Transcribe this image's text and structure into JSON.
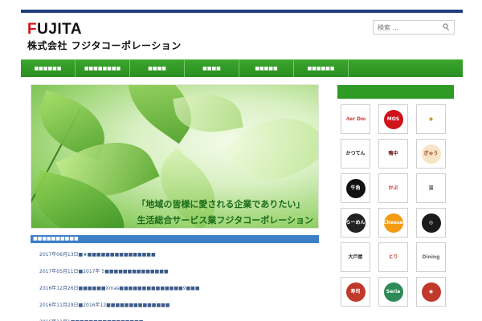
{
  "header": {
    "logo_mark_prefix": "F",
    "logo_mark_rest": "UJITA",
    "logo_sub": "株式会社 フジタコーポレーション",
    "search_placeholder": "検索 ...",
    "search_icon": "search-icon"
  },
  "nav": {
    "items": [
      "■■■■■■",
      "■■■■■■■■",
      "■■■■",
      "■■■■",
      "■■■■■",
      "■■■■■■"
    ]
  },
  "hero": {
    "line1": "「地域の皆様に愛される企業でありたい」",
    "line2": "生活総合サービス業フジタコーポレーション"
  },
  "news": {
    "header": "■■■■■■■■■■",
    "items": [
      "2017年06月13日■★■■■■■■■■■■■■■■■",
      "2017年05月11日■2017年 5■■■■■■■■■■■■■■",
      "2016年12月26日■■■■■■Xmas■■■■■■■■■■■■■■9■■■",
      "2016年11月29日■2016年12■■■■■■■■■■■■■■",
      "2016年11月1■■■■■■■■■■■■■■■■"
    ]
  },
  "brands": [
    {
      "label": "Mister\nDonut",
      "color": "#c0392b",
      "bg": "#ffffff"
    },
    {
      "label": "MOS",
      "color": "#ffffff",
      "bg": "#d0121b"
    },
    {
      "label": "◉",
      "color": "#b8860b",
      "bg": "#ffffff"
    },
    {
      "label": "かつてん",
      "color": "#222222",
      "bg": "#ffffff"
    },
    {
      "label": "鴨中",
      "color": "#7a1a1a",
      "bg": "#ffffff"
    },
    {
      "label": "ぎゅう",
      "color": "#a0522d",
      "bg": "#f7e4c8"
    },
    {
      "label": "牛角",
      "color": "#ffffff",
      "bg": "#111111"
    },
    {
      "label": "かぶ",
      "color": "#b33",
      "bg": "#ffffff"
    },
    {
      "label": "温",
      "color": "#555555",
      "bg": "#ffffff"
    },
    {
      "label": "らーめん",
      "color": "#ffffff",
      "bg": "#222222"
    },
    {
      "label": "Cheese",
      "color": "#ffffff",
      "bg": "#f39c12"
    },
    {
      "label": "◎",
      "color": "#ffffff",
      "bg": "#1a1a1a"
    },
    {
      "label": "大戸屋",
      "color": "#333333",
      "bg": "#ffffff"
    },
    {
      "label": "とり",
      "color": "#c0392b",
      "bg": "#ffffff"
    },
    {
      "label": "Dining",
      "color": "#666666",
      "bg": "#ffffff"
    },
    {
      "label": "寿司",
      "color": "#ffffff",
      "bg": "#c0392b"
    },
    {
      "label": "Seria",
      "color": "#ffffff",
      "bg": "#2e8b57"
    },
    {
      "label": "◉",
      "color": "#ffffff",
      "bg": "#c0392b"
    }
  ]
}
